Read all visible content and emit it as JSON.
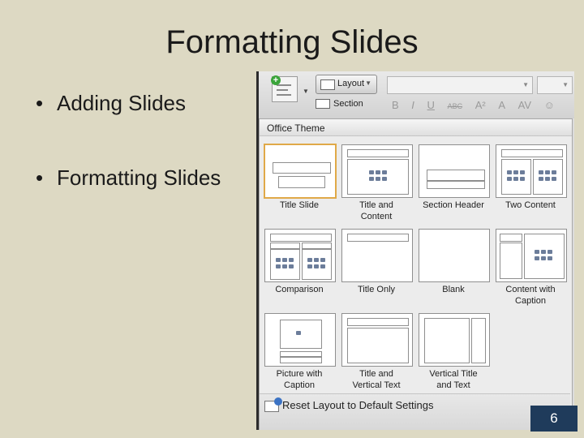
{
  "slide": {
    "title": "Formatting Slides",
    "bullets": [
      "Adding Slides",
      "Formatting Slides"
    ],
    "bullet_char": "•",
    "page_number": "6"
  },
  "ribbon": {
    "layout_label": "Layout",
    "section_label": "Section",
    "format_buttons": [
      "B",
      "I",
      "U",
      "ABC",
      "A²",
      "A",
      "AV",
      "☺"
    ]
  },
  "gallery": {
    "header": "Office Theme",
    "layouts": [
      {
        "label": "Title Slide",
        "selected": true
      },
      {
        "label": "Title and\nContent"
      },
      {
        "label": "Section Header"
      },
      {
        "label": "Two Content"
      },
      {
        "label": "Comparison"
      },
      {
        "label": "Title Only"
      },
      {
        "label": "Blank"
      },
      {
        "label": "Content with\nCaption"
      },
      {
        "label": "Picture with\nCaption"
      },
      {
        "label": "Title and\nVertical Text"
      },
      {
        "label": "Vertical Title\nand Text"
      }
    ],
    "footer_label": "Reset Layout to Default Settings"
  },
  "colors": {
    "slide_background": "#ddd9c3",
    "selected_border": "#e0a948",
    "page_number_bg": "#1f3b5b"
  }
}
